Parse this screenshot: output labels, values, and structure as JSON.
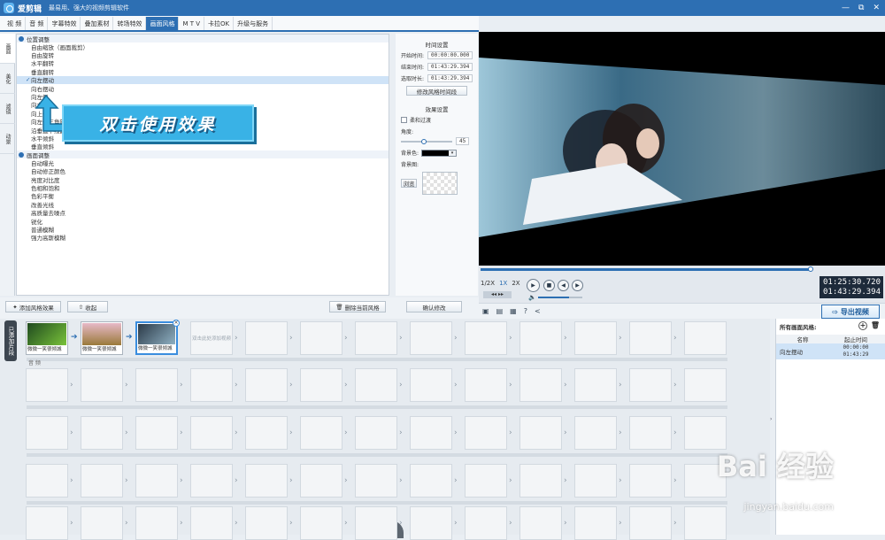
{
  "window": {
    "app_name": "爱剪辑",
    "subtitle": "最易用、强大的视频剪辑软件",
    "controls": [
      "—",
      "▭",
      "⧉",
      "✕"
    ]
  },
  "tabs": [
    "视 频",
    "音 频",
    "字幕特效",
    "叠加素材",
    "转场特效",
    "画面风格",
    "M T V",
    "卡拉OK",
    "升级与服务"
  ],
  "active_tab": "画面风格",
  "side_tabs": [
    "画面",
    "美化",
    "滤镜",
    "动景"
  ],
  "effects": {
    "group1": "位置调整",
    "group1_items": [
      "自由缩放（画面裁剪）",
      "自由旋转",
      "水平翻转",
      "垂直翻转",
      "向左摆动",
      "向右摆动",
      "向左倒",
      "向右倒",
      "向上倒",
      "向左倒三角旋转",
      "沿垂直中线翻转",
      "水平倾斜",
      "垂直倾斜"
    ],
    "selected": "向左摆动",
    "group2": "画面调整",
    "group2_items": [
      "自动曝光",
      "自动修正颜色",
      "亮度对比度",
      "色相和饱和",
      "色彩平衡",
      "改善光线",
      "高质量去噪点",
      "锐化",
      "普通模糊",
      "强力高斯模糊"
    ]
  },
  "tooltip": "双击使用效果",
  "settings": {
    "time_title": "时间设置",
    "start_label": "开始时间:",
    "start_value": "00:00:00.000",
    "end_label": "结束时间:",
    "end_value": "01:43:29.394",
    "duration_label": "选取时长:",
    "duration_value": "01:43:29.394",
    "modify_time_btn": "修改风格时间段",
    "effect_title": "效果设置",
    "soft_transition": "柔和过渡",
    "angle_label": "角度:",
    "angle_value": "45",
    "angle_level": 0.45,
    "bg_color_label": "背景色:",
    "bg_color": "#000000",
    "bg_image_label": "背景图:",
    "browse_btn": "浏览",
    "confirm_btn": "确认修改"
  },
  "left_buttons": {
    "add": "添加风格效果",
    "collapse": "收起",
    "delete": "删除当前风格"
  },
  "player": {
    "speed_labels": [
      "1/2X",
      "1X",
      "2X"
    ],
    "active_speed": "1X",
    "current_time": "01:25:30.720",
    "total_time": "01:43:29.394",
    "progress": 0.82,
    "volume": 0.7
  },
  "export_label": "导出视频",
  "timeline": {
    "tab": "已添加片段",
    "clips": [
      "微微一笑很倾城",
      "微微一笑很倾城",
      "微微一笑很倾城"
    ],
    "placeholder": "双击此处添加视频",
    "audio_label": "音 频"
  },
  "right_panel": {
    "title": "所有画面风格:",
    "col_name": "名称",
    "col_time": "起止时间",
    "row_name": "向左摆动",
    "row_start": "00:00:00",
    "row_end": "01:43:29"
  },
  "watermark": {
    "text": "Bai 经验",
    "url": "jingyan.baidu.com"
  }
}
